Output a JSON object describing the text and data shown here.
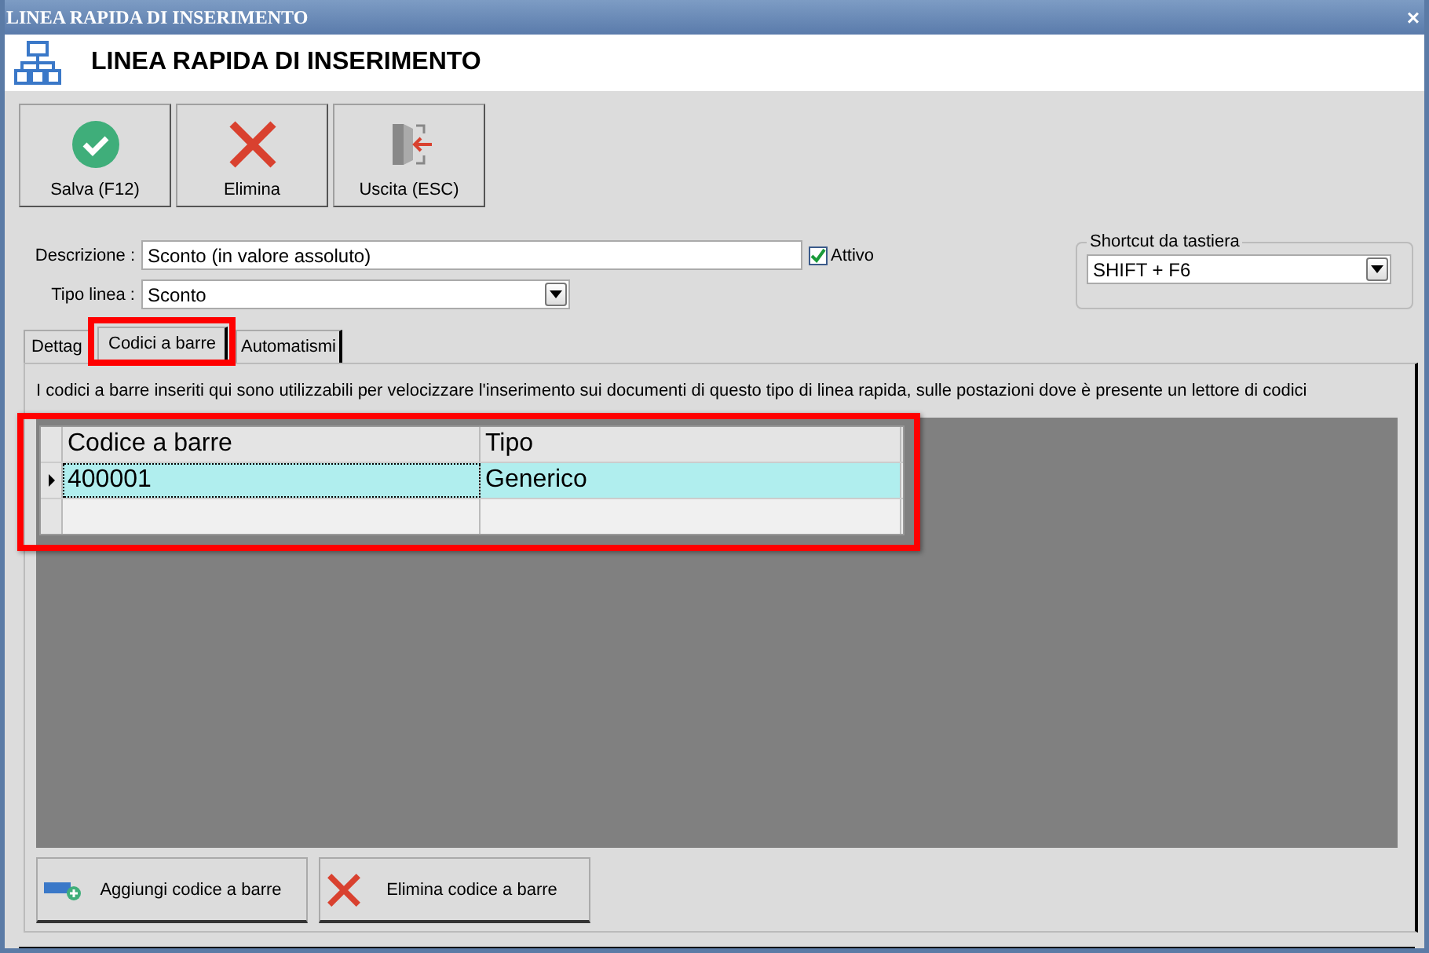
{
  "window": {
    "title": "LINEA RAPIDA DI INSERIMENTO",
    "close": "×"
  },
  "header": {
    "title": "LINEA RAPIDA DI INSERIMENTO"
  },
  "toolbar": [
    {
      "label": "Salva (F12)",
      "kind": "save"
    },
    {
      "label": "Elimina",
      "kind": "delete"
    },
    {
      "label": "Uscita (ESC)",
      "kind": "exit"
    }
  ],
  "form": {
    "descrizione": {
      "label": "Descrizione :",
      "value": "Sconto (in valore assoluto)"
    },
    "attivo": {
      "label": "Attivo",
      "checked": true
    },
    "tipo_linea": {
      "label": "Tipo linea :",
      "value": "Sconto"
    }
  },
  "shortcut": {
    "legend": "Shortcut da tastiera",
    "value": "SHIFT + F6"
  },
  "tabs": [
    {
      "label": "Dettag",
      "selected": false,
      "highlighted": false
    },
    {
      "label": "Codici a barre",
      "selected": true,
      "highlighted": true
    },
    {
      "label": "Automatismi",
      "selected": false,
      "highlighted": false
    }
  ],
  "info": "I codici a barre inseriti qui sono utilizzabili per velocizzare l'inserimento sui documenti di questo tipo di linea rapida, sulle postazioni dove è presente un lettore di codici",
  "grid": {
    "highlighted": true,
    "columns": [
      "Codice a barre",
      "Tipo"
    ],
    "rows": [
      {
        "cells": [
          "400001",
          "Generico"
        ],
        "selected": true
      }
    ]
  },
  "actions": [
    {
      "label": "Aggiungi codice a barre",
      "kind": "add"
    },
    {
      "label": "Elimina codice a barre",
      "kind": "delete"
    }
  ]
}
